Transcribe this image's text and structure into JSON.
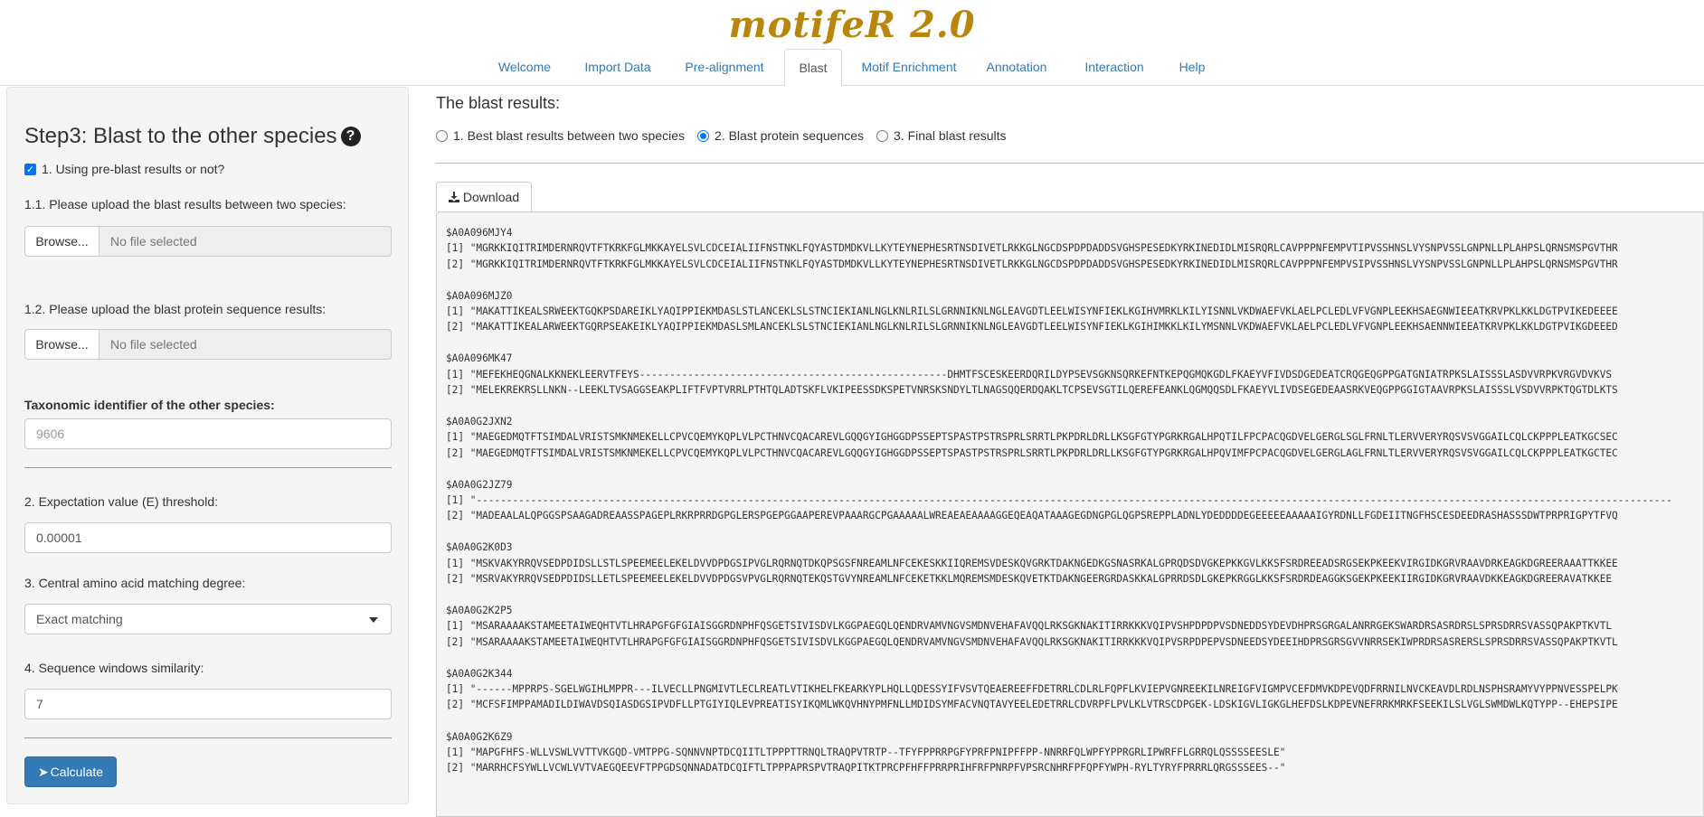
{
  "app": {
    "title": "motifeR 2.0",
    "brand_color": "#b8860b",
    "accent": "#337ab7"
  },
  "tabs": [
    {
      "label": "Welcome"
    },
    {
      "label": "Import Data"
    },
    {
      "label": "Pre-alignment"
    },
    {
      "label": "Blast"
    },
    {
      "label": "Motif Enrichment"
    },
    {
      "label": "Annotation"
    },
    {
      "label": "Interaction"
    },
    {
      "label": "Help"
    }
  ],
  "active_tab": "Blast",
  "sidebar": {
    "title": "Step3: Blast to the other species",
    "help_icon": "question-circle-icon",
    "pre_blast_label": "1. Using pre-blast results or not?",
    "pre_blast_checked": true,
    "upload1_label": "1.1. Please upload the blast results between two species:",
    "upload1_button": "Browse...",
    "upload1_placeholder": "No file selected",
    "upload2_label": "1.2. Please upload the blast protein sequence results:",
    "upload2_button": "Browse...",
    "upload2_placeholder": "No file selected",
    "taxid_label": "Taxonomic identifier of the other species:",
    "taxid_placeholder": "9606",
    "evalue_label": "2. Expectation value (E) threshold:",
    "evalue_value": "0.00001",
    "central_label": "3. Central amino acid matching degree:",
    "central_value": "Exact matching",
    "window_label": "4. Sequence windows similarity:",
    "window_value": "7",
    "calculate_label": "Calculate"
  },
  "main": {
    "title": "The blast results:",
    "radio_options": [
      {
        "label": "1. Best blast results between two species",
        "selected": false
      },
      {
        "label": "2. Blast protein sequences",
        "selected": true
      },
      {
        "label": "3. Final blast results",
        "selected": false
      }
    ],
    "download_label": "Download",
    "results": [
      {
        "id": "$A0A096MJY4",
        "seq1": "[1] \"MGRKKIQITRIMDERNRQVTFTKRKFGLMKKAYELSVLCDCEIALIIFNSTNKLFQYASTDMDKVLLKYTEYNEPHESRTNSDIVETLRKKGLNGCDSPDPDADDSVGHSPESEDKYRKINEDIDLMISRQRLCAVPPPNFEMPVTIPVSSHNSLVYSNPVSSLGNPNLLPLAHPSLQRNSMSPGVTHR",
        "seq2": "[2] \"MGRKKIQITRIMDERNRQVTFTKRKFGLMKKAYELSVLCDCEIALIIFNSTNKLFQYASTDMDKVLLKYTEYNEPHESRTNSDIVETLRKKGLNGCDSPDPDADDSVGHSPESEDKYRKINEDIDLMISRQRLCAVPPPNFEMPVSIPVSSHNSLVYSNPVSSLGNPNLLPLAHPSLQRNSMSPGVTHR"
      },
      {
        "id": "$A0A096MJZ0",
        "seq1": "[1] \"MAKATTIKEALSRWEEKTGQKPSDAREIKLYAQIPPIEKMDASLSTLANCEKLSLSTNCIEKIANLNGLKNLRILSLGRNNIKNLNGLEAVGDTLEELWISYNFIEKLKGIHVMRKLKILYISNNLVKDWAEFVKLAELPCLEDLVFVGNPLEEKHSAEGNWIEEATKRVPKLKKLDGTPVIKEDEEEE",
        "seq2": "[2] \"MAKATTIKEALARWEEKTGQRPSEAKEIKLYAQIPPIEKMDASLSMLANCEKLSLSTNCIEKIANLNGLKNLRILSLGRNNIKNLNGLEAVGDTLEELWISYNFIEKLKGIHIMKKLKILYMSNNLVKDWAEFVKLAELPCLEDLVFVGNPLEEKHSAENNWIEEATKRVPKLKKLDGTPVIKGDEEED"
      },
      {
        "id": "$A0A096MK47",
        "seq1": "[1] \"MEFEKHEQGNALKKNEKLEERVTFEYS---------------------------------------------------DHMTFSCESKEERDQRILDYPSEVSGKNSQRKEFNTKEPQGMQKGDLFKAEYVFIVDSDGEDEATCRQGEQGPPGATGNIATRPKSLAISSSLASDVVRPKVRGVDVKVS",
        "seq2": "[2] \"MELEKREKRSLLNKN--LEEKLTVSAGGSEAKPLIFTFVPTVRRLPTHTQLADTSKFLVKIPEESSDKSPETVNRSKSNDYLTLNAGSQQERDQAKLTCPSEVSGTILQEREFEANKLQGMQQSDLFKAEYVLIVDSEGEDEAASRKVEQGPPGGIGTAAVRPKSLAISSSLVSDVVRPKTQGTDLKTS"
      },
      {
        "id": "$A0A0G2JXN2",
        "seq1": "[1] \"MAEGEDMQTFTSIMDALVRISTSMKNMEKELLCPVCQEMYKQPLVLPCTHNVCQACAREVLGQQGYIGHGGDPSSEPTSPASTPSTRSPRLSRRTLPKPDRLDRLLKSGFGTYPGRKRGALHPQTILFPCPACQGDVELGERGLSGLFRNLTLERVVERYRQSVSVGGAILCQLCKPPPLEATKGCSEC",
        "seq2": "[2] \"MAEGEDMQTFTSIMDALVRISTSMKNMEKELLCPVCQEMYKQPLVLPCTHNVCQACAREVLGQQGYIGHGGDPSSEPTSPASTPSTRSPRLSRRTLPKPDRLDRLLKSGFGTYPGRKRGALHPQVIMFPCPACQGDVELGERGLAGLFRNLTLERVVERYRQSVSVGGAILCQLCKPPPLEATKGCTEC"
      },
      {
        "id": "$A0A0G2JZ79",
        "seq1": "[1] \"------------------------------------------------------------------------------------------------------------------------------------------------------------------------------------------------------",
        "seq2": "[2] \"MADEAALALQPGGSPSAAGADREAASSPAGEPLRKRPRRDGPGLERSPGEPGGAAPEREVPAAARGCPGAAAAALWREAEAEAAAAGGEQEAQATAAAGEGDNGPGLQGPSREPPLADNLYDEDDDDEGEEEEEAAAAAIGYRDNLLFGDEIITNGFHSCESDEEDRASHASSSDWTPRPRIGPYTFVQ"
      },
      {
        "id": "$A0A0G2K0D3",
        "seq1": "[1] \"MSKVAKYRRQVSEDPDIDSLLSTLSPEEMEELEKELDVVDPDGSIPVGLRQRNQTDKQPSGSFNREAMLNFCEKESKKIIQREMSVDESKQVGRKTDAKNGEDKGSNASRKALGPRQDSDVGKEPKKGVLKKSFSRDREEADSRGSEKPKEEKVIRGIDKGRVRAAVDRKEAGKDGREERAAATTKKEE",
        "seq2": "[2] \"MSRVAKYRRQVSEDPDIDSLLETLSPEEMEELEKELDVVDPDGSVPVGLRQRNQTEKQSTGVYNREAMLNFCEKETKKLMQREMSMDESKQVETKTDAKNGEERGRDASKKALGPRRDSDLGKEPKRGGLKKSFSRDRDEAGGKSGEKPKEEKIIRGIDKGRVRAAVDKKEAGKDGREERAVATKKEE"
      },
      {
        "id": "$A0A0G2K2P5",
        "seq1": "[1] \"MSARAAAAKSTAMEETAIWEQHTVTLHRAPGFGFGIAISGGRDNPHFQSGETSIVISDVLKGGPAEGQLQENDRVAMVNGVSMDNVEHAFAVQQLRKSGKNAKITIRRKKKVQIPVSHPDPDPVSDNEDDSYDEVDHPRSGRGALANRRGEKSWARDRSASRDRSLSPRSDRRSVASSQPAKPTKVTL",
        "seq2": "[2] \"MSARAAAAKSTAMEETAIWEQHTVTLHRAPGFGFGIAISGGRDNPHFQSGETSIVISDVLKGGPAEGQLQENDRVAMVNGVSMDNVEHAFAVQQLRKSGKNAKITIRRKKKVQIPVSRPDPEPVSDNEEDSYDEEIHDPRSGRSGVVNRRSEKIWPRDRSASRERSLSPRSDRRSVASSQPAKPTKVTL"
      },
      {
        "id": "$A0A0G2K344",
        "seq1": "[1] \"------MPPRPS-SGELWGIHLMPPR---ILVECLLPNGMIVTLECLREATLVTIKHELFKEARKYPLHQLLQDESSYIFVSVTQEAEREEFFDETRRLCDLRLFQPFLKVIEPVGNREEKILNREIGFVIGMPVCEFDMVKDPEVQDFRRNILNVCKEAVDLRDLNSPHSRAMYVYPPNVESSPELPK",
        "seq2": "[2] \"MCFSFIMPPAMADILDIWAVDSQIASDGSIPVDFLLPTGIYIQLEVPREATISYIKQMLWKQVHNYPMFNLLMDIDSYMFACVNQTAVYEELEDETRRLCDVRPFLPVLKLVTRSCDPGEK-LDSKIGVLIGKGLHEFDSLKDPEVNEFRRKMRKFSEEKILSLVGLSWMDWLKQTYPP--EHEPSIPE"
      },
      {
        "id": "$A0A0G2K6Z9",
        "seq1": "[1] \"MAPGFHFS-WLLVSWLVVTTVKGQD-VMTPPG-SQNNVNPTDCQIITLTPPPTTRNQLTRAQPVTRTP--TFYFPPRRPGFYPRFPNIPFFPP-NNRRFQLWPFYPPRGRLIPWRFFLGRRQLQSSSSEESLE\"",
        "seq2": "[2] \"MARRHCFSYWLLVCWLVVTVAEGQEEVFTPPGDSQNNADATDCQIFTLTPPPAPRSPVTRAQPITKTPRCPFHFFPRRPRIHFRFPNRPFVPSRCNHRFPFQPFYWPH-RYLTYRYFPRRRLQRGSSSEES--\""
      }
    ]
  }
}
